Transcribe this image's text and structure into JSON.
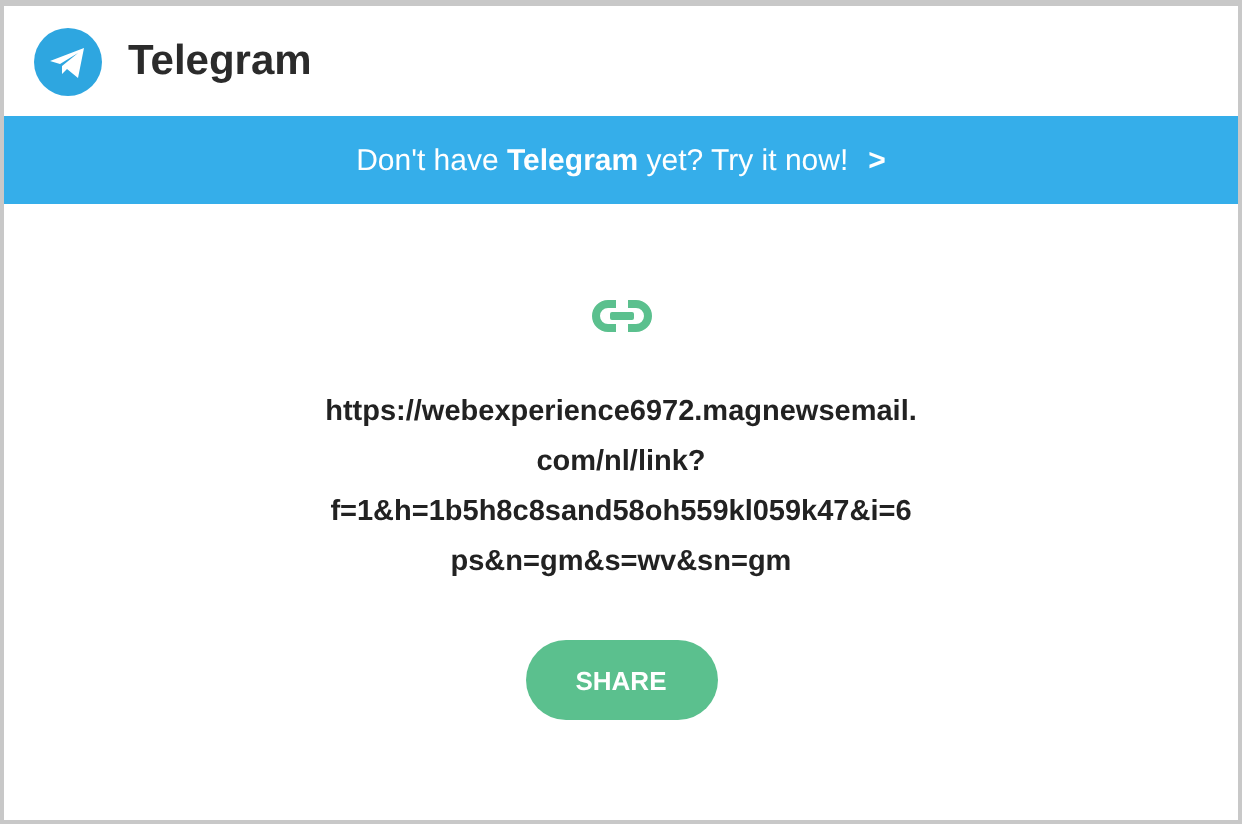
{
  "header": {
    "title": "Telegram"
  },
  "banner": {
    "text": "Don't have **Telegram** yet? Try it now!",
    "chevron": ">"
  },
  "link": {
    "url_lines": [
      "https://webexperience6972.magnewsemail.",
      "com/nl/link?",
      "f=1&h=1b5h8c8sand58oh559kl059k47&i=6",
      "ps&n=gm&s=wv&sn=gm"
    ]
  },
  "share_button": {
    "label": "SHARE"
  }
}
